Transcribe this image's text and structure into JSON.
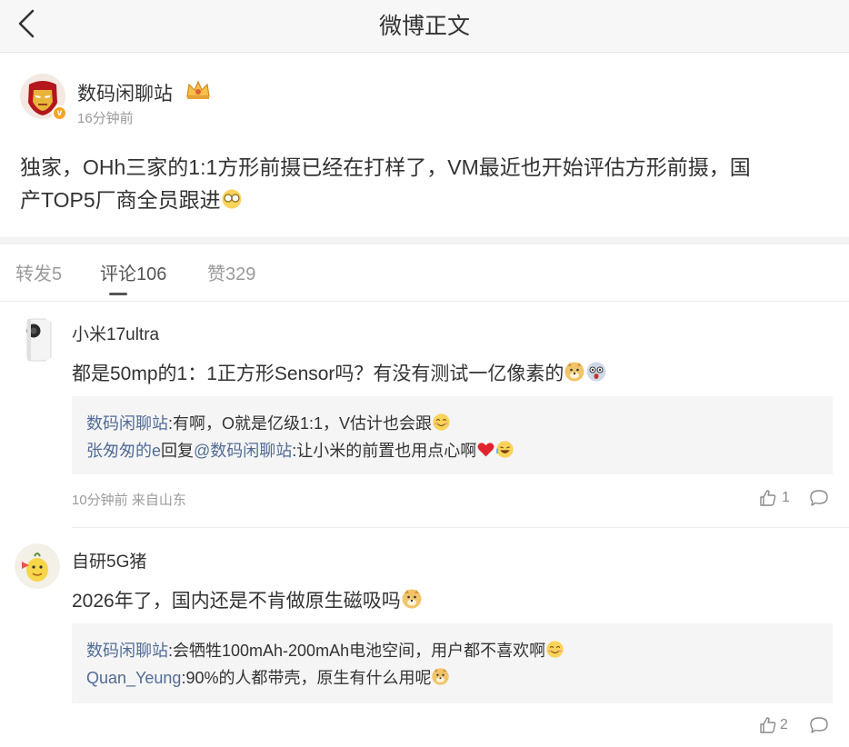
{
  "header": {
    "title": "微博正文"
  },
  "post": {
    "author": "数码闲聊站",
    "time": "16分钟前",
    "text_line1": "独家，OHh三家的1:1方形前摄已经在打样了，VM最近也开始评估方形前摄，国",
    "text_line2": "产TOP5厂商全员跟进"
  },
  "tabs": {
    "repost": "转发5",
    "comments": "评论106",
    "likes": "赞329"
  },
  "comments": [
    {
      "name": "小米17ultra",
      "text": "都是50mp的1：1正方形Sensor吗？有没有测试一亿像素的",
      "replies": [
        {
          "user": "数码闲聊站",
          "text": ":有啊，O就是亿级1:1，V估计也会跟"
        },
        {
          "user": "张匆匆的e",
          "mid": "回复",
          "user2": "@数码闲聊站",
          "text": ":让小米的前置也用点心啊"
        }
      ],
      "meta": "10分钟前 来自山东",
      "likes": "1"
    },
    {
      "name": "自研5G猪",
      "text": "2026年了，国内还是不肯做原生磁吸吗",
      "replies": [
        {
          "user": "数码闲聊站",
          "text": ":会牺牲100mAh-200mAh电池空间，用户都不喜欢啊"
        },
        {
          "user": "Quan_Yeung",
          "text": ":90%的人都带壳，原生有什么用呢"
        }
      ],
      "likes": "2"
    }
  ],
  "colors": {
    "link": "#526c96",
    "badge": "#f5a623",
    "meta": "#9b9b9b"
  }
}
